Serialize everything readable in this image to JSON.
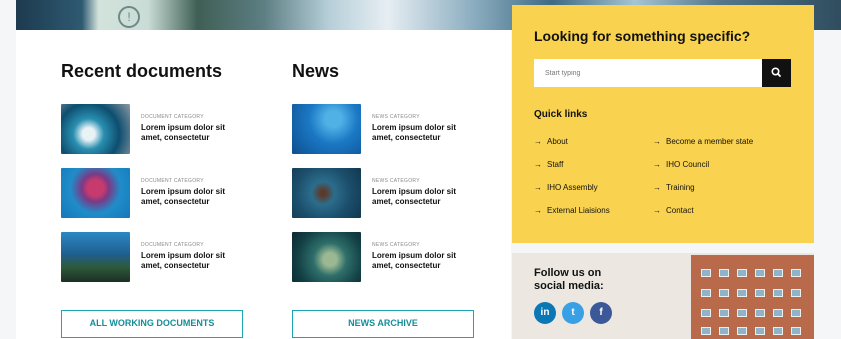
{
  "left_column": {
    "title": "Recent documents",
    "items": [
      {
        "category": "DOCUMENT CATEGORY",
        "title": "Lorem ipsum dolor sit amet, consectetur"
      },
      {
        "category": "DOCUMENT CATEGORY",
        "title": "Lorem ipsum dolor sit amet, consectetur"
      },
      {
        "category": "DOCUMENT CATEGORY",
        "title": "Lorem ipsum dolor sit amet, consectetur"
      }
    ],
    "button_label": "ALL WORKING DOCUMENTS"
  },
  "news_column": {
    "title": "News",
    "items": [
      {
        "category": "NEWS CATEGORY",
        "title": "Lorem ipsum dolor sit amet, consectetur"
      },
      {
        "category": "NEWS CATEGORY",
        "title": "Lorem ipsum dolor sit amet, consectetur"
      },
      {
        "category": "NEWS CATEGORY",
        "title": "Lorem ipsum dolor sit amet, consectetur"
      }
    ],
    "button_label": "NEWS ARCHIVE"
  },
  "sidebar": {
    "title": "Looking for something specific?",
    "search_placeholder": "Start typing",
    "search_icon": "search-icon",
    "quick_links_title": "Quick links",
    "quick_links": [
      "About",
      "Become a member state",
      "Staff",
      "IHO Council",
      "IHO Assembly",
      "Training",
      "External Liaisions",
      "Contact"
    ]
  },
  "follow": {
    "text": "Follow us on social media:",
    "networks": [
      {
        "icon": "linkedin-icon",
        "glyph": "in",
        "color": "#0b77b5"
      },
      {
        "icon": "twitter-icon",
        "glyph": "t",
        "color": "#3aa0e6"
      },
      {
        "icon": "facebook-icon",
        "glyph": "f",
        "color": "#3b5998"
      }
    ]
  },
  "colors": {
    "accent_yellow": "#f9d34f",
    "button_teal": "#1aa6b2",
    "search_button": "#111111"
  }
}
